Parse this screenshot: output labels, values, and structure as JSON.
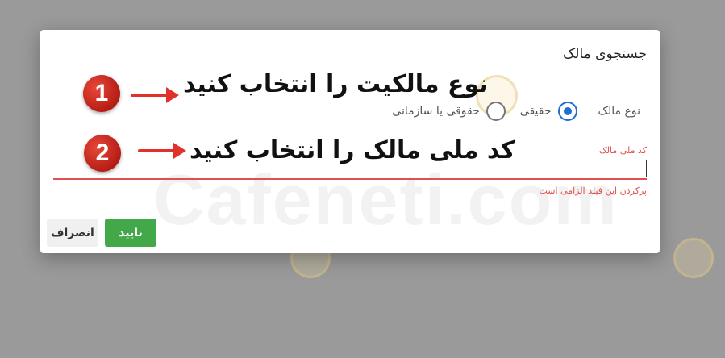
{
  "dialog": {
    "title": "جستجوی مالک",
    "ownership": {
      "label": "نوع مالک",
      "options": [
        "حقیقی",
        "حقوقی یا سازمانی"
      ],
      "selected": "حقیقی"
    },
    "national_code": {
      "label": "کد ملی مالک",
      "value": "",
      "error": "پرکردن این فیلد الزامی است"
    },
    "buttons": {
      "confirm": "تایید",
      "cancel": "انصراف"
    }
  },
  "annotations": {
    "step1": {
      "number": "1",
      "text": "نوع مالکیت را انتخاب کنید"
    },
    "step2": {
      "number": "2",
      "text": "کد ملی مالک را انتخاب کنید"
    }
  },
  "watermark": "Cafeneti.com",
  "colors": {
    "accent_blue": "#1e6fd0",
    "error_red": "#e05050",
    "confirm_green": "#43a84a",
    "badge_red": "#c8261d"
  }
}
